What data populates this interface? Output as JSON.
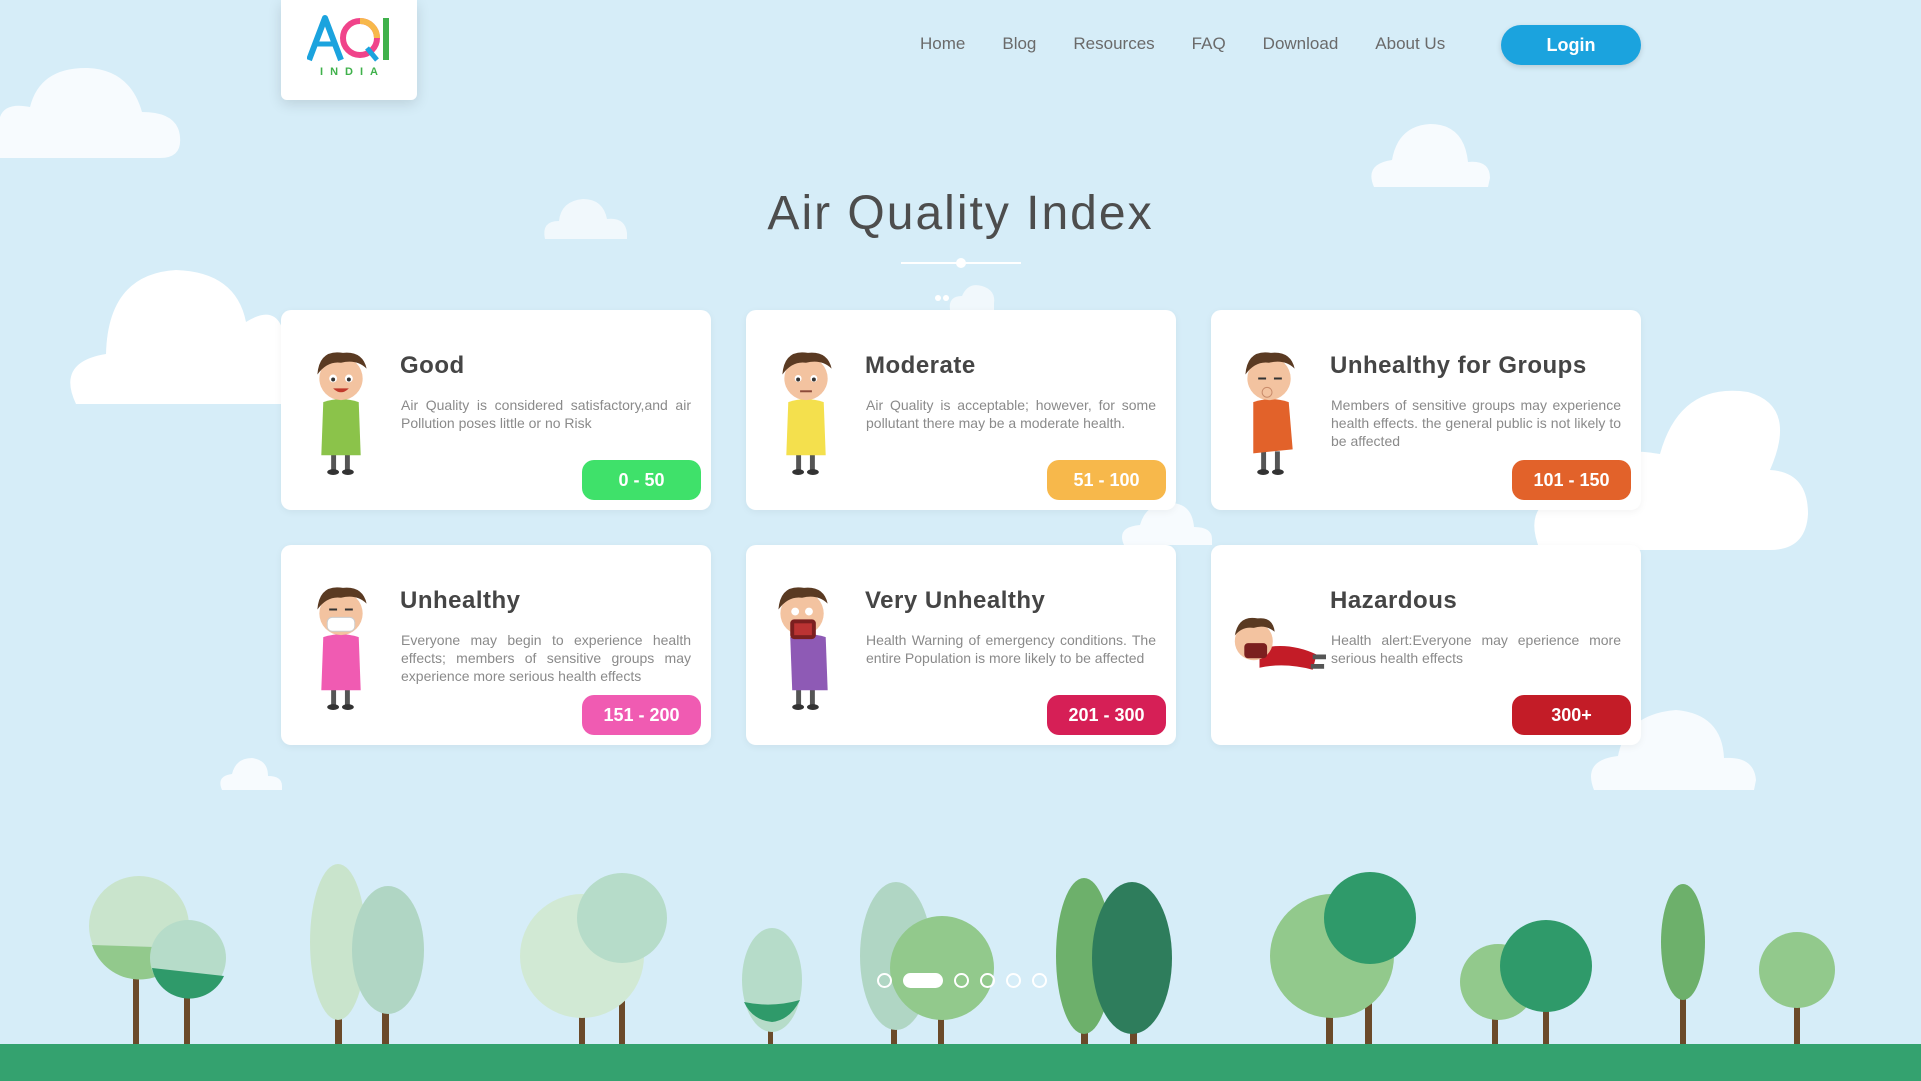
{
  "brand": {
    "logo_text": "AQI",
    "logo_sub": "INDIA"
  },
  "nav": {
    "items": [
      "Home",
      "Blog",
      "Resources",
      "FAQ",
      "Download",
      "About Us"
    ],
    "login_label": "Login"
  },
  "main": {
    "title": "Air Quality Index",
    "categories": [
      {
        "title": "Good",
        "description": "Air Quality is considered satisfactory,and air Pollution poses little or no Risk",
        "range": "0 - 50",
        "color": "#3fe16a"
      },
      {
        "title": "Moderate",
        "description": "Air Quality is acceptable; however, for some pollutant there may be a moderate health.",
        "range": "51 - 100",
        "color": "#f7b84b"
      },
      {
        "title": "Unhealthy for Groups",
        "description": "Members of sensitive groups may experience health effects. the general public is not likely to be affected",
        "range": "101 - 150",
        "color": "#e2622a"
      },
      {
        "title": "Unhealthy",
        "description": "Everyone may begin to experience health effects; members of sensitive groups may experience more serious health effects",
        "range": "151 - 200",
        "color": "#f05bb2"
      },
      {
        "title": "Very Unhealthy",
        "description": "Health Warning of emergency conditions. The entire Population is more likely to be affected",
        "range": "201 - 300",
        "color": "#d61f56"
      },
      {
        "title": "Hazardous",
        "description": "Health alert:Everyone may eperience more serious health effects",
        "range": "300+",
        "color": "#c31c27"
      }
    ]
  },
  "carousel": {
    "slide_count": 6,
    "active_index": 1
  }
}
